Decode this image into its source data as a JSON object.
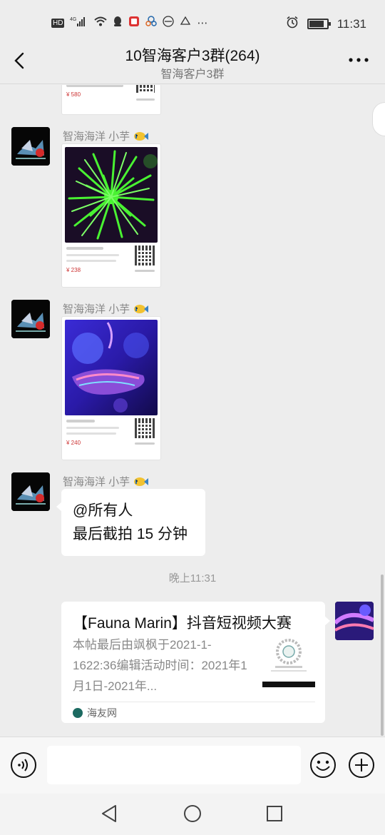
{
  "status_bar": {
    "left_indicators": "HD ⁴ᴳ",
    "time": "11:31",
    "battery_level": 0.85
  },
  "header": {
    "title": "10智海客户3群(264)",
    "subtitle": "智海客户3群"
  },
  "messages": [
    {
      "type": "product_card",
      "sender": "",
      "price": "¥ 580",
      "image_theme": "partial-top"
    },
    {
      "type": "product_card",
      "sender": "智海海洋  小芋",
      "price": "¥ 238",
      "image_theme": "green-anemone"
    },
    {
      "type": "product_card",
      "sender": "智海海洋  小芋",
      "price": "¥ 240",
      "image_theme": "blue-coral"
    },
    {
      "type": "text",
      "sender": "智海海洋  小芋",
      "lines": [
        "@所有人",
        "最后截拍 15 分钟"
      ]
    }
  ],
  "timestamp": "晚上11:31",
  "link_card": {
    "title": "【Fauna Marin】抖音短视频大赛",
    "description": "本帖最后由飒枫于2021-1-1622:36编辑活动时间：2021年1月1日-2021年...",
    "source": "海友网"
  },
  "input": {
    "placeholder": "",
    "value": ""
  },
  "icons": {
    "back": "back-arrow-icon",
    "more": "more-dots-icon",
    "voice": "voice-icon",
    "emoji": "emoji-icon",
    "plus": "plus-icon"
  },
  "colors": {
    "background": "#ededed",
    "bubble": "#ffffff",
    "price": "#cc3333"
  }
}
